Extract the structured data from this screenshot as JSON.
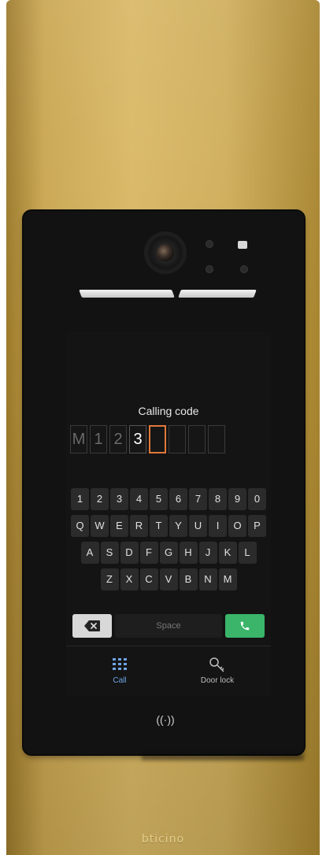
{
  "screen": {
    "title": "Calling code",
    "code_boxes": [
      "M",
      "1",
      "2",
      "3",
      "",
      "",
      "",
      ""
    ],
    "keyboard_rows": [
      [
        "1",
        "2",
        "3",
        "4",
        "5",
        "6",
        "7",
        "8",
        "9",
        "0"
      ],
      [
        "Q",
        "W",
        "E",
        "R",
        "T",
        "Y",
        "U",
        "I",
        "O",
        "P"
      ],
      [
        "A",
        "S",
        "D",
        "F",
        "G",
        "H",
        "J",
        "K",
        "L"
      ],
      [
        "Z",
        "X",
        "C",
        "V",
        "B",
        "N",
        "M"
      ]
    ],
    "space_label": "Space"
  },
  "tabs": {
    "call_label": "Call",
    "door_lock_label": "Door lock"
  },
  "nfc_label": "((·))",
  "brand": "bticino",
  "colors": {
    "active_tab": "#6ea4e8",
    "call_button": "#3ab56a",
    "cursor_box": "#e0783a",
    "frame_gold": "#d9b865"
  }
}
